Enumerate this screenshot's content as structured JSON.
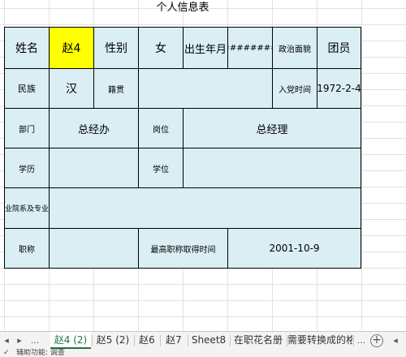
{
  "title": "个人信息表",
  "form": {
    "row1": {
      "name_label": "姓名",
      "name_value": "赵4",
      "gender_label": "性别",
      "gender_value": "女",
      "birth_label": "出生年月",
      "birth_value": "########",
      "political_label": "政治面貌",
      "political_value": "团员"
    },
    "row2": {
      "ethnic_label": "民族",
      "ethnic_value": "汉",
      "native_label": "籍贯",
      "native_value": "",
      "party_label": "入党时间",
      "party_value": "1972-2-4"
    },
    "row3": {
      "dept_label": "部门",
      "dept_value": "总经办",
      "post_label": "岗位",
      "post_value": "总经理"
    },
    "row4": {
      "edu_label": "学历",
      "edu_value": "",
      "degree_label": "学位",
      "degree_value": ""
    },
    "row5": {
      "school_label": "专业院系及专业",
      "school_value": ""
    },
    "row6": {
      "title_label": "职称",
      "title_value": "",
      "title_date_label": "最高职称取得时间",
      "title_date_value": "2001-10-9"
    },
    "highlight_color": "#ffff00",
    "cell_color": "#daeef3"
  },
  "tabs": {
    "nav_prev": "◂",
    "nav_next": "▸",
    "nav_more": "...",
    "items": [
      "赵4 (2)",
      "赵5 (2)",
      "赵6",
      "赵7",
      "Sheet8",
      "在职花名册",
      "需要转换成的格式"
    ],
    "active_index": 0,
    "overflow": "...",
    "add": "+",
    "scroll_arrow": "◂"
  },
  "status": {
    "text": "辅助功能: 调查"
  }
}
